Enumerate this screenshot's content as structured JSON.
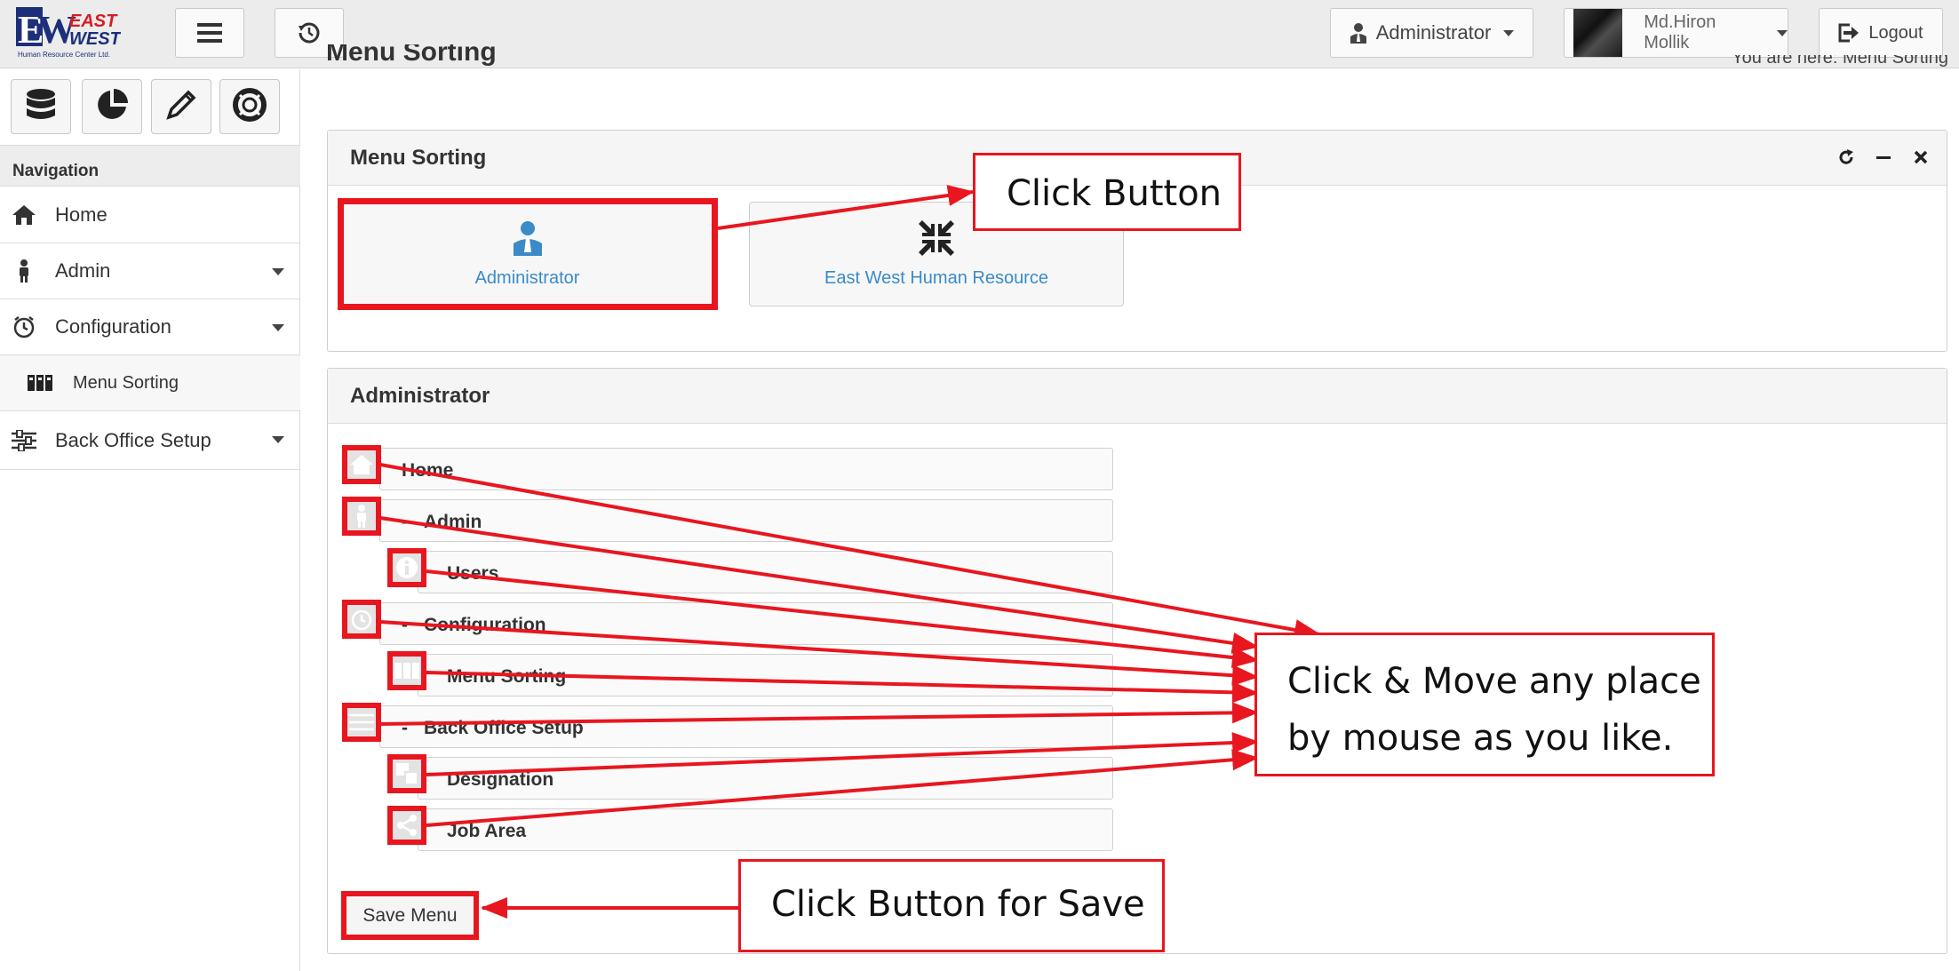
{
  "topbar": {
    "brand": {
      "line1": "EAST",
      "line2": "WEST",
      "initials": "EW",
      "tagline": "Human Resource Center Ltd."
    },
    "role_label": "Administrator",
    "user_name": "Md.Hiron Mollik",
    "logout_label": "Logout"
  },
  "page": {
    "title": "Menu Sorting",
    "breadcrumb": "You are here: Menu Sorting"
  },
  "sidebar": {
    "header": "Navigation",
    "items": [
      {
        "label": "Home",
        "icon": "home-icon"
      },
      {
        "label": "Admin",
        "icon": "user-icon"
      },
      {
        "label": "Configuration",
        "icon": "clock-icon"
      },
      {
        "label": "Menu Sorting",
        "icon": "columns-icon"
      },
      {
        "label": "Back Office Setup",
        "icon": "sliders-icon"
      }
    ]
  },
  "menu_sorting_panel": {
    "title": "Menu Sorting",
    "roles": [
      {
        "label": "Administrator",
        "icon": "user-tie-icon"
      },
      {
        "label": "East West Human Resource",
        "icon": "compress-icon"
      }
    ]
  },
  "administrator_panel": {
    "title": "Administrator",
    "tree": [
      {
        "label": "Home",
        "icon": "home-icon",
        "level": 0
      },
      {
        "label": "Admin",
        "icon": "user-icon",
        "level": 0,
        "prefix": "-"
      },
      {
        "label": "Users",
        "icon": "info-icon",
        "level": 1
      },
      {
        "label": "Configuration",
        "icon": "clock-icon",
        "level": 0,
        "prefix": "-"
      },
      {
        "label": "Menu Sorting",
        "icon": "columns-icon",
        "level": 1
      },
      {
        "label": "Back Office Setup",
        "icon": "sliders-icon",
        "level": 0,
        "prefix": "-"
      },
      {
        "label": "Designation",
        "icon": "clone-icon",
        "level": 1
      },
      {
        "label": "Job Area",
        "icon": "share-icon",
        "level": 1
      }
    ],
    "save_label": "Save Menu"
  },
  "annotations": {
    "click_button": "Click Button",
    "drag_line1": "Click & Move any place",
    "drag_line2": "by mouse as you like.",
    "save": "Click Button for Save"
  },
  "colors": {
    "annotation": "#e8161f",
    "link": "#3a8bc8"
  }
}
